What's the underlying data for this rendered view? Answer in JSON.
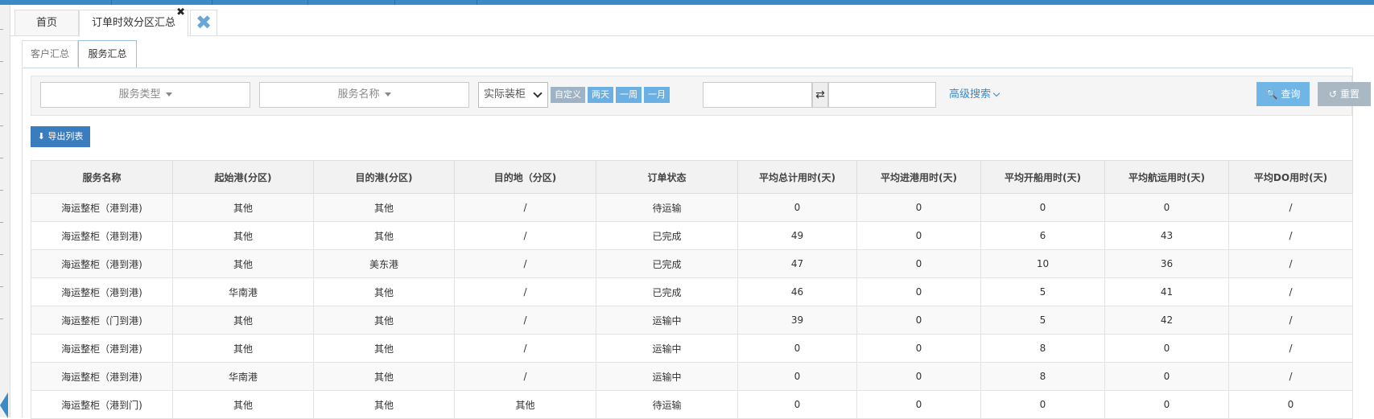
{
  "tabs": {
    "home": "首页",
    "current": "订单时效分区汇总",
    "close_symbol": "✖"
  },
  "subtabs": [
    "客户汇总",
    "服务汇总"
  ],
  "search": {
    "service_type": "服务类型",
    "service_name": "服务名称",
    "date_type": "实际装柜",
    "quick": [
      "自定义",
      "两天",
      "一周",
      "一月"
    ],
    "swap_symbol": "⇄",
    "advanced": "高级搜索",
    "query": "查询",
    "reset": "重置"
  },
  "export_label": "导出列表",
  "table": {
    "headers": [
      "服务名称",
      "起始港(分区)",
      "目的港(分区)",
      "目的地（分区)",
      "订单状态",
      "平均总计用时(天)",
      "平均进港用时(天)",
      "平均开船用时(天)",
      "平均航运用时(天)",
      "平均DO用时(天)"
    ],
    "rows": [
      [
        "海运整柜（港到港)",
        "其他",
        "其他",
        "/",
        "待运输",
        "0",
        "0",
        "0",
        "0",
        "/"
      ],
      [
        "海运整柜（港到港)",
        "其他",
        "其他",
        "/",
        "已完成",
        "49",
        "0",
        "6",
        "43",
        "/"
      ],
      [
        "海运整柜（港到港)",
        "其他",
        "美东港",
        "/",
        "已完成",
        "47",
        "0",
        "10",
        "36",
        "/"
      ],
      [
        "海运整柜（港到港)",
        "华南港",
        "其他",
        "/",
        "已完成",
        "46",
        "0",
        "5",
        "41",
        "/"
      ],
      [
        "海运整柜（门到港)",
        "其他",
        "其他",
        "/",
        "运输中",
        "39",
        "0",
        "5",
        "42",
        "/"
      ],
      [
        "海运整柜（港到港)",
        "其他",
        "其他",
        "/",
        "运输中",
        "0",
        "0",
        "8",
        "0",
        "/"
      ],
      [
        "海运整柜（港到港)",
        "华南港",
        "其他",
        "/",
        "运输中",
        "0",
        "0",
        "8",
        "0",
        "/"
      ],
      [
        "海运整柜（港到门)",
        "其他",
        "其他",
        "其他",
        "待运输",
        "0",
        "0",
        "0",
        "0",
        "0"
      ]
    ]
  }
}
